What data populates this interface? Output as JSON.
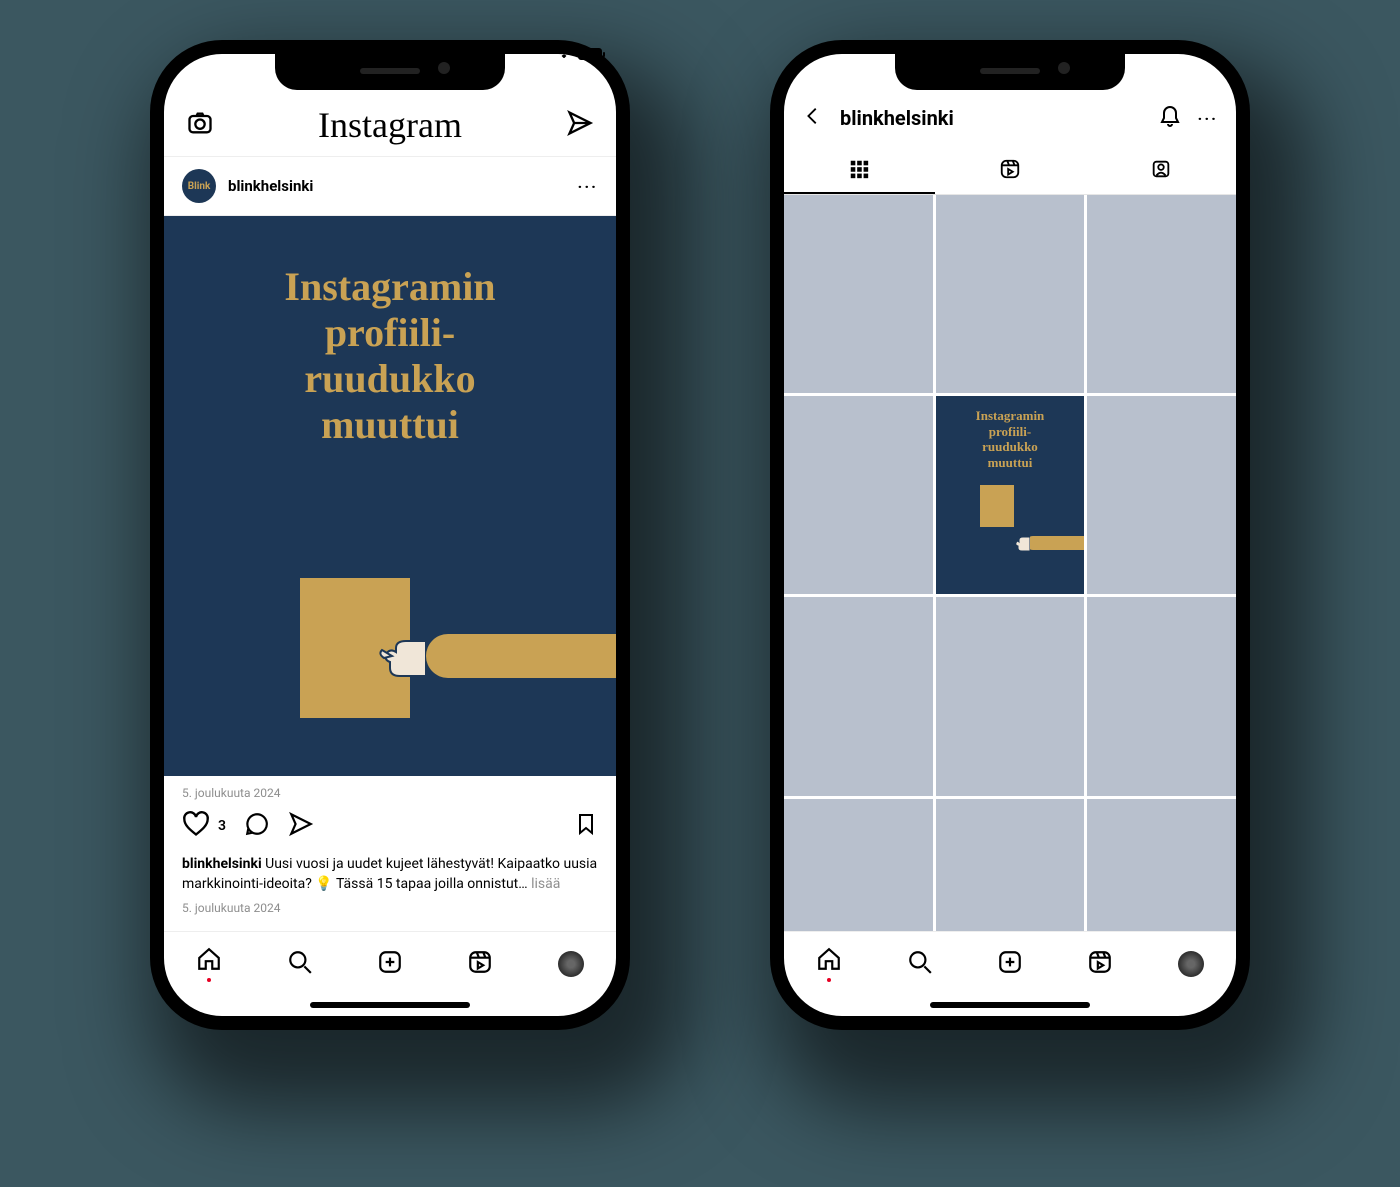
{
  "app_name": "Instagram",
  "account": {
    "username": "blinkhelsinki",
    "avatar_label": "Blink"
  },
  "post": {
    "image_text_l1": "Instagramin",
    "image_text_l2": "profiili-",
    "image_text_l3": "ruudukko",
    "image_text_l4": "muuttui",
    "date": "5. joulukuuta 2024",
    "like_count": "3",
    "caption_user": "blinkhelsinki",
    "caption_text": " Uusi vuosi ja uudet kujeet lähestyvät! Kaipaatko uusia markkinointi-ideoita? 💡 Tässä 15 tapaa joilla onnistut… ",
    "more_label": "lisää",
    "date2": "5. joulukuuta 2024"
  },
  "profile_grid": {
    "center_text_l1": "Instagramin",
    "center_text_l2": "profiili-",
    "center_text_l3": "ruudukko",
    "center_text_l4": "muuttui"
  },
  "icons": {
    "camera": "camera",
    "send": "send",
    "more": "···",
    "heart": "heart",
    "comment": "comment",
    "share": "share",
    "bookmark": "bookmark",
    "home": "home",
    "search": "search",
    "add": "add",
    "reels": "reels",
    "profile": "profile",
    "back": "back",
    "bell": "bell",
    "grid": "grid",
    "tagged": "tagged"
  }
}
